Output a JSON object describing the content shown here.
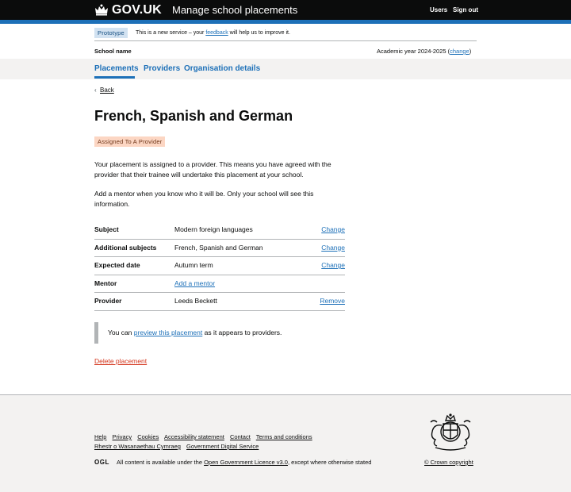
{
  "header": {
    "logo": "GOV.UK",
    "service": "Manage school placements",
    "nav": {
      "users": "Users",
      "sign_out": "Sign out"
    }
  },
  "phase": {
    "tag": "Prototype",
    "text_before": "This is a new service – your ",
    "link": "feedback",
    "text_after": " will help us to improve it."
  },
  "school": {
    "name": "School name",
    "academic_label": "Academic year 2024-2025 (",
    "change": "change",
    "close": ")"
  },
  "subnav": [
    "Placements",
    "Providers",
    "Organisation details"
  ],
  "back": "Back",
  "title": "French, Spanish and German",
  "status": "Assigned To A Provider",
  "para1": "Your placement is assigned to a provider. This means you have agreed with the provider that their trainee will undertake this placement at your school.",
  "para2": "Add a mentor when you know who it will be. Only your school will see this information.",
  "summary": [
    {
      "key": "Subject",
      "value": "Modern foreign languages",
      "action": "Change"
    },
    {
      "key": "Additional subjects",
      "value": "French, Spanish and German",
      "action": "Change"
    },
    {
      "key": "Expected date",
      "value": "Autumn term",
      "action": "Change"
    },
    {
      "key": "Mentor",
      "value": "Add a mentor",
      "action": ""
    },
    {
      "key": "Provider",
      "value": "Leeds Beckett",
      "action": "Remove"
    }
  ],
  "inset": {
    "before": "You can ",
    "link": "preview this placement",
    "after": " as it appears to providers."
  },
  "delete": "Delete placement",
  "footer": {
    "links": [
      "Help",
      "Privacy",
      "Cookies",
      "Accessibility statement",
      "Contact",
      "Terms and conditions"
    ],
    "links2": [
      "Rhestr o Wasanaethau Cymraeg",
      "Government Digital Service"
    ],
    "ogl": "OGL",
    "licence_before": "All content is available under the ",
    "licence_link": "Open Government Licence v3.0",
    "licence_after": ", except where otherwise stated",
    "copyright": "© Crown copyright"
  }
}
